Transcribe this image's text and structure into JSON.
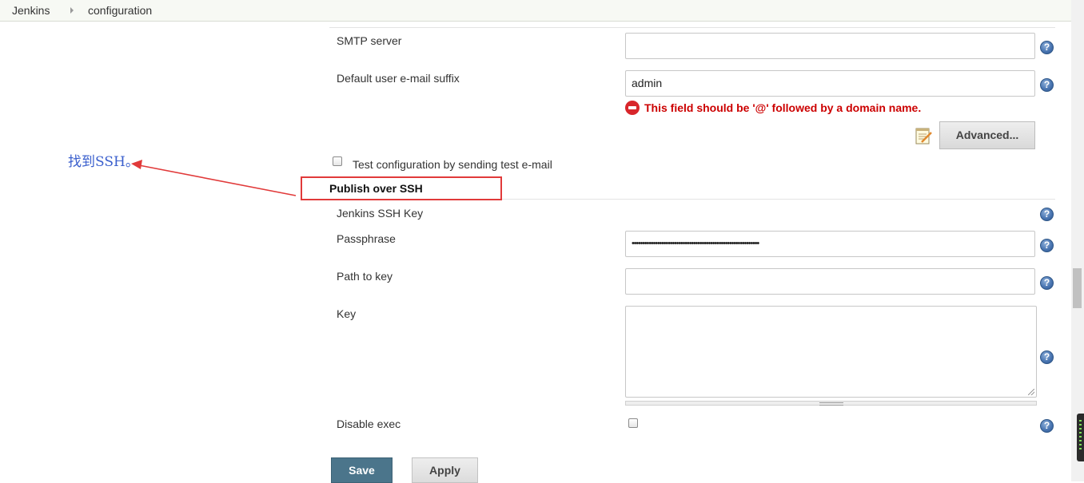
{
  "breadcrumb": {
    "root": "Jenkins",
    "current": "configuration"
  },
  "email": {
    "smtp_server_label": "SMTP server",
    "smtp_server_value": "",
    "suffix_label": "Default user e-mail suffix",
    "suffix_value": "admin",
    "error_message": "This field should be '@' followed by a domain name.",
    "advanced_label": "Advanced...",
    "test_config_label": "Test configuration by sending test e-mail"
  },
  "ssh": {
    "section_title": "Publish over SSH",
    "jenkins_ssh_key_label": "Jenkins SSH Key",
    "passphrase_label": "Passphrase",
    "passphrase_mask": "••••••••••••••••••••••••••••••••••••••••••••••••••••••••••••",
    "path_to_key_label": "Path to key",
    "path_to_key_value": "",
    "key_label": "Key",
    "key_value": "",
    "disable_exec_label": "Disable exec"
  },
  "buttons": {
    "save": "Save",
    "apply": "Apply"
  },
  "help_glyph": "?",
  "annotation": {
    "text": "找到SSH。",
    "color": "#3a5fcd",
    "arrow_color": "#e13a3a"
  },
  "colors": {
    "error": "#cc0000",
    "save_button": "#4b758b",
    "highlight": "#e13a3a"
  }
}
